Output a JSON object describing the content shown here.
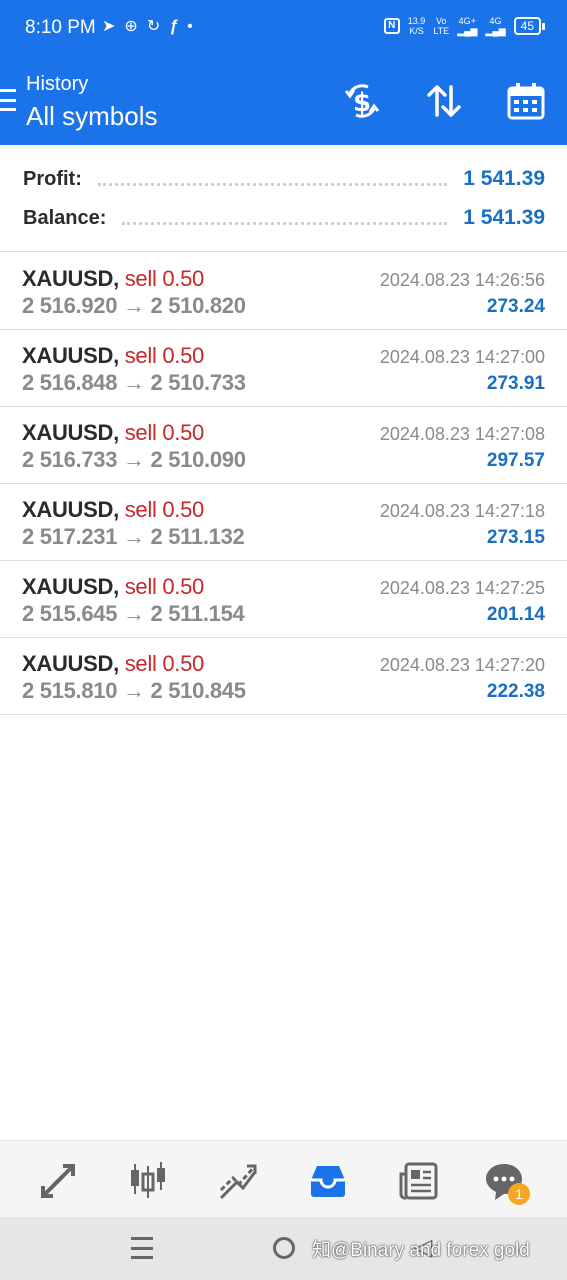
{
  "status_bar": {
    "time": "8:10 PM",
    "left_icons": [
      "telegram-icon",
      "compass-icon",
      "sync-icon",
      "fx-icon",
      "dot-icon"
    ],
    "nfc": "N",
    "speed_value": "13.9",
    "speed_unit": "K/S",
    "volte_top": "Vo",
    "volte_bottom": "LTE",
    "network_1": "4G+",
    "network_2": "4G",
    "battery": "45"
  },
  "app_bar": {
    "subtitle": "History",
    "title": "All symbols",
    "actions": [
      "exchange-dollar-icon",
      "sort-icon",
      "calendar-icon"
    ]
  },
  "summary": {
    "profit_label": "Profit:",
    "profit_value": "1 541.39",
    "balance_label": "Balance:",
    "balance_value": "1 541.39"
  },
  "deals": [
    {
      "symbol": "XAUUSD,",
      "type": "sell 0.50",
      "prices": "2 516.920 → 2 510.820",
      "time": "2024.08.23 14:26:56",
      "profit": "273.24"
    },
    {
      "symbol": "XAUUSD,",
      "type": "sell 0.50",
      "prices": "2 516.848 → 2 510.733",
      "time": "2024.08.23 14:27:00",
      "profit": "273.91"
    },
    {
      "symbol": "XAUUSD,",
      "type": "sell 0.50",
      "prices": "2 516.733 → 2 510.090",
      "time": "2024.08.23 14:27:08",
      "profit": "297.57"
    },
    {
      "symbol": "XAUUSD,",
      "type": "sell 0.50",
      "prices": "2 517.231 → 2 511.132",
      "time": "2024.08.23 14:27:18",
      "profit": "273.15"
    },
    {
      "symbol": "XAUUSD,",
      "type": "sell 0.50",
      "prices": "2 515.645 → 2 511.154",
      "time": "2024.08.23 14:27:25",
      "profit": "201.14"
    },
    {
      "symbol": "XAUUSD,",
      "type": "sell 0.50",
      "prices": "2 515.810 → 2 510.845",
      "time": "2024.08.23 14:27:20",
      "profit": "222.38"
    }
  ],
  "bottom_nav": {
    "items": [
      "quotes-icon",
      "chart-icon",
      "trade-icon",
      "history-icon",
      "news-icon",
      "messages-icon"
    ],
    "active": "history-icon",
    "messages_badge": "1"
  },
  "system_nav": {
    "watermark": "知@Binary and forex  gold"
  },
  "colors": {
    "primary": "#1a73e8",
    "profit_blue": "#1a6fc4",
    "sell_red": "#c62828",
    "badge_orange": "#f5a623"
  }
}
